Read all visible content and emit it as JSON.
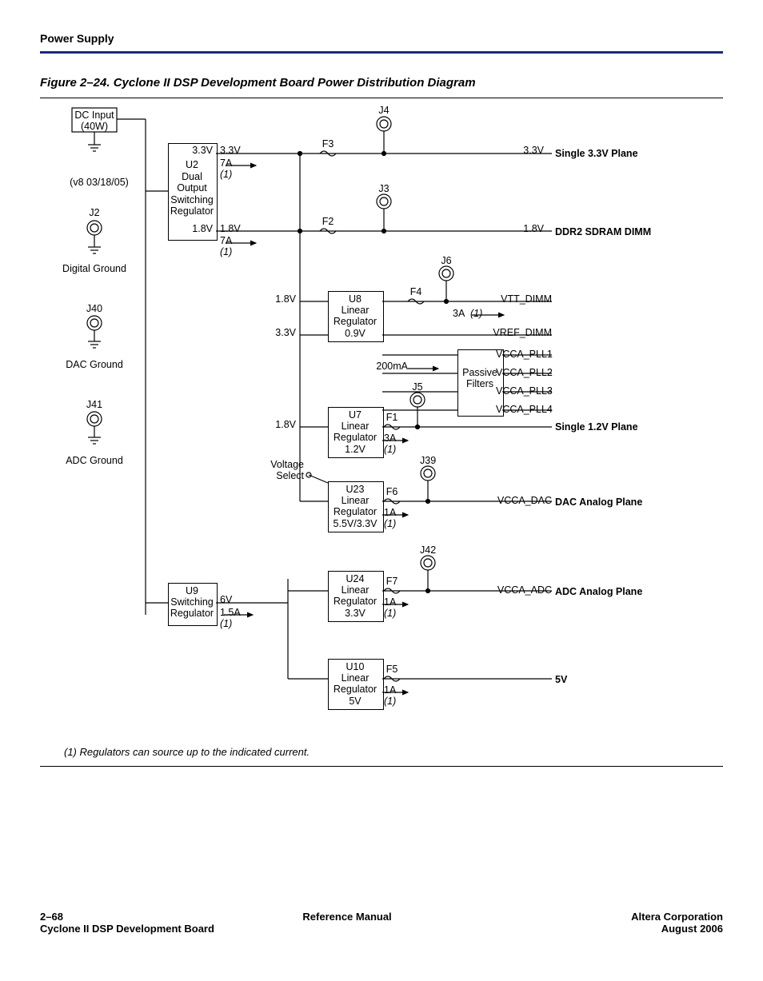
{
  "header": {
    "section": "Power Supply"
  },
  "figure": {
    "caption": "Figure 2–24. Cyclone II DSP Development Board Power Distribution Diagram"
  },
  "leftcol": {
    "dcinput": "DC Input\n(40W)",
    "version": "(v8 03/18/05)",
    "j2": "J2",
    "j2_lbl": "Digital Ground",
    "j40": "J40",
    "j40_lbl": "DAC Ground",
    "j41": "J41",
    "j41_lbl": "ADC Ground"
  },
  "u2": {
    "name": "U2",
    "desc": "Dual\nOutput\nSwitching\nRegulator",
    "v1": "3.3V",
    "v2": "1.8V"
  },
  "u9": {
    "name": "U9",
    "desc": "Switching\nRegulator",
    "out": "6V",
    "amp": "1.5A",
    "note": "(1)"
  },
  "u8": {
    "name": "U8",
    "desc": "Linear\nRegulator\n0.9V",
    "amp": "200mA"
  },
  "u7": {
    "name": "U7",
    "desc": "Linear\nRegulator\n1.2V",
    "amp": "3A",
    "note": "(1)"
  },
  "u23": {
    "name": "U23",
    "desc": "Linear\nRegulator\n5.5V/3.3V",
    "amp": "1A",
    "note": "(1)"
  },
  "u24": {
    "name": "U24",
    "desc": "Linear\nRegulator\n3.3V",
    "amp": "1A",
    "note": "(1)"
  },
  "u10": {
    "name": "U10",
    "desc": "Linear\nRegulator\n5V",
    "amp": "1A",
    "note": "(1)"
  },
  "rails": {
    "r33v_left": "3.3V",
    "r33v_mid": "3.3V",
    "r33v_right": "3.3V",
    "r18v_left": "1.8V",
    "r18v_mid": "1.8V",
    "r18v_right": "1.8V",
    "r18v_tap1": "1.8V",
    "r33v_tap": "3.3V",
    "r18v_tap2": "1.8V",
    "amp7a_1": "7A",
    "amp7a_2": "7A",
    "amp3a": "3A",
    "note1a": "(1)",
    "note1b": "(1)",
    "note1c": "(1)"
  },
  "fuses": {
    "f1": "F1",
    "f2": "F2",
    "f3": "F3",
    "f4": "F4",
    "f5": "F5",
    "f6": "F6",
    "f7": "F7"
  },
  "conns": {
    "j3": "J3",
    "j4": "J4",
    "j5": "J5",
    "j6": "J6",
    "j39": "J39",
    "j42": "J42"
  },
  "vsel": "Voltage\nSelect",
  "pf": "Passive\nFilters",
  "outputs": {
    "plane33": "Single 3.3V Plane",
    "ddr2": "DDR2 SDRAM DIMM",
    "vtt": "VTT_DIMM",
    "vref": "VREF_DIMM",
    "pll1": "VCCA_PLL1",
    "pll2": "VCCA_PLL2",
    "pll3": "VCCA_PLL3",
    "pll4": "VCCA_PLL4",
    "plane12": "Single 1.2V Plane",
    "vccadac": "VCCA_DAC",
    "dacplane": "DAC Analog Plane",
    "vccaadc": "VCCA_ADC",
    "adcplane": "ADC Analog Plane",
    "v5": "5V"
  },
  "footnote": "(1) Regulators can source up to the indicated current.",
  "footer": {
    "page": "2–68",
    "center": "Reference Manual",
    "right1": "Altera Corporation",
    "left2": "Cyclone II DSP Development Board",
    "right2": "August 2006"
  }
}
